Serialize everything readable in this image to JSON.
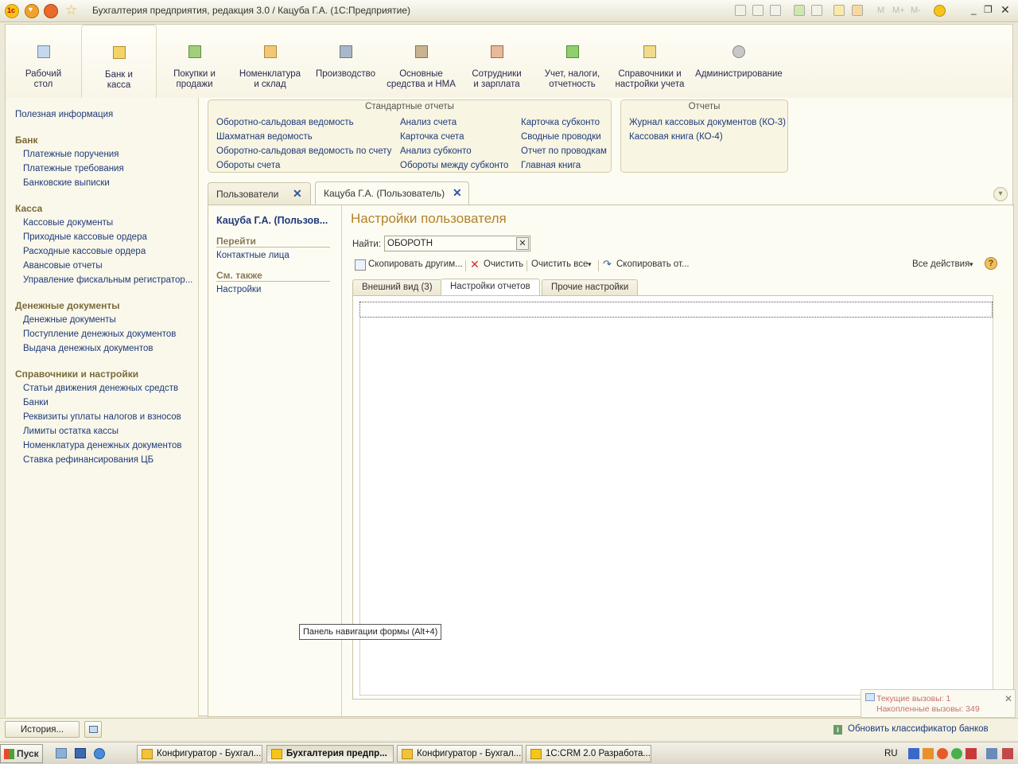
{
  "window": {
    "title": "Бухгалтерия предприятия, редакция 3.0 / Кацуба Г.А.  (1С:Предприятие)",
    "m_buttons": [
      "M",
      "M+",
      "M-"
    ]
  },
  "sections": [
    {
      "label": "Рабочий\nстол",
      "icon": "desk-icon"
    },
    {
      "label": "Банк и\nкасса",
      "icon": "bank-icon"
    },
    {
      "label": "Покупки и\nпродажи",
      "icon": "purchases-icon"
    },
    {
      "label": "Номенклатура\nи склад",
      "icon": "warehouse-icon"
    },
    {
      "label": "Производство",
      "icon": "production-icon"
    },
    {
      "label": "Основные\nсредства и НМА",
      "icon": "assets-icon"
    },
    {
      "label": "Сотрудники\nи зарплата",
      "icon": "employees-icon"
    },
    {
      "label": "Учет, налоги,\nотчетность",
      "icon": "taxes-icon"
    },
    {
      "label": "Справочники и\nнастройки учета",
      "icon": "catalogs-icon"
    },
    {
      "label": "Администрирование",
      "icon": "gear-icon"
    }
  ],
  "leftnav": {
    "useful": "Полезная информация",
    "groups": [
      {
        "title": "Банк",
        "items": [
          "Платежные поручения",
          "Платежные требования",
          "Банковские выписки"
        ]
      },
      {
        "title": "Касса",
        "items": [
          "Кассовые документы",
          "Приходные кассовые ордера",
          "Расходные кассовые ордера",
          "Авансовые отчеты",
          "Управление фискальным регистратор..."
        ]
      },
      {
        "title": "Денежные документы",
        "items": [
          "Денежные документы",
          "Поступление денежных документов",
          "Выдача денежных документов"
        ]
      },
      {
        "title": "Справочники и настройки",
        "items": [
          "Статьи движения денежных средств",
          "Банки",
          "Реквизиты уплаты налогов и взносов",
          "Лимиты остатка кассы",
          "Номенклатура денежных документов",
          "Ставка рефинансирования ЦБ"
        ]
      }
    ]
  },
  "reports": {
    "standard_title": "Стандартные отчеты",
    "col1": [
      "Оборотно-сальдовая ведомость",
      "Шахматная ведомость",
      "Оборотно-сальдовая ведомость по счету",
      "Обороты счета"
    ],
    "col2": [
      "Анализ счета",
      "Карточка счета",
      "Анализ субконто",
      "Обороты между субконто"
    ],
    "col3": [
      "Карточка субконто",
      "Сводные проводки",
      "Отчет по проводкам",
      "Главная книга"
    ],
    "other_title": "Отчеты",
    "other": [
      "Журнал кассовых документов (КО-3)",
      "Кассовая книга (КО-4)"
    ]
  },
  "tabs": [
    {
      "label": "Пользователи",
      "close": "✕"
    },
    {
      "label": "Кацуба Г.А. (Пользователь)",
      "close": "✕"
    }
  ],
  "formnav": {
    "title": "Кацуба Г.А. (Пользов...",
    "goto_head": "Перейти",
    "goto_items": [
      "Контактные лица"
    ],
    "see_head": "См. также",
    "see_items": [
      "Настройки"
    ]
  },
  "form": {
    "title": "Настройки пользователя",
    "find_label": "Найти:",
    "find_value": "ОБОРОТН",
    "toolbar": {
      "copy_to": "Скопировать другим...",
      "clear": "Очистить",
      "clear_all": "Очистить все",
      "copy_from": "Скопировать от...",
      "all_actions": "Все действия"
    },
    "tabs": [
      "Внешний вид (3)",
      "Настройки отчетов",
      "Прочие настройки"
    ]
  },
  "tooltip": "Панель навигации формы (Alt+4)",
  "calls": {
    "current": "Текущие вызовы: 1",
    "accumulated": "Накопленные вызовы: 349"
  },
  "status": {
    "history": "История...",
    "update_banks": "Обновить классификатор банков"
  },
  "taskbar": {
    "start": "Пуск",
    "tasks": [
      "Конфигуратор - Бухгал...",
      "Бухгалтерия предпр...",
      "Конфигуратор - Бухгал...",
      "1С:CRM 2.0  Разработа..."
    ],
    "lang": "RU"
  },
  "colors": {
    "accent": "#b2822a",
    "link": "#1f3a7a",
    "background": "#fdfcf3"
  }
}
